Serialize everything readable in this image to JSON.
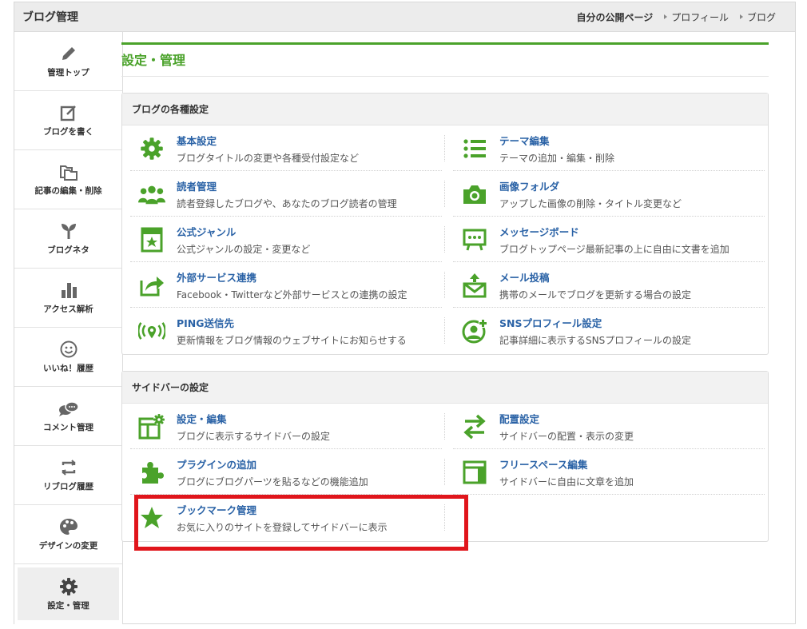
{
  "app": {
    "title": "ブログ管理"
  },
  "topnav": [
    {
      "label": "自分の公開ページ",
      "bold": true
    },
    {
      "label": "プロフィール"
    },
    {
      "label": "ブログ"
    }
  ],
  "sidebar": {
    "items": [
      {
        "label": "管理トップ",
        "icon": "pencil-icon"
      },
      {
        "label": "ブログを書く",
        "icon": "edit-icon"
      },
      {
        "label": "記事の編集・削除",
        "icon": "folders-icon"
      },
      {
        "label": "ブログネタ",
        "icon": "sprout-icon"
      },
      {
        "label": "アクセス解析",
        "icon": "bar-chart-icon"
      },
      {
        "label": "いいね！履歴",
        "icon": "smile-icon"
      },
      {
        "label": "コメント管理",
        "icon": "comment-icon"
      },
      {
        "label": "リブログ履歴",
        "icon": "reblog-icon"
      },
      {
        "label": "デザインの変更",
        "icon": "palette-icon"
      },
      {
        "label": "設定・管理",
        "icon": "gear-icon",
        "active": true
      }
    ]
  },
  "main": {
    "title": "設定・管理",
    "sections": [
      {
        "title": "ブログの各種設定",
        "items": [
          {
            "title": "基本設定",
            "desc": "ブログタイトルの変更や各種受付設定など",
            "icon": "gear-icon"
          },
          {
            "title": "テーマ編集",
            "desc": "テーマの追加・編集・削除",
            "icon": "list-icon"
          },
          {
            "title": "読者管理",
            "desc": "読者登録したブログや、あなたのブログ読者の管理",
            "icon": "users-icon"
          },
          {
            "title": "画像フォルダ",
            "desc": "アップした画像の削除・タイトル変更など",
            "icon": "camera-icon"
          },
          {
            "title": "公式ジャンル",
            "desc": "公式ジャンルの設定・変更など",
            "icon": "genre-icon"
          },
          {
            "title": "メッセージボード",
            "desc": "ブログトップページ最新記事の上に自由に文書を追加",
            "icon": "board-icon"
          },
          {
            "title": "外部サービス連携",
            "desc": "Facebook・Twitterなど外部サービスとの連携の設定",
            "icon": "share-icon"
          },
          {
            "title": "メール投稿",
            "desc": "携帯のメールでブログを更新する場合の設定",
            "icon": "mail-upload-icon"
          },
          {
            "title": "PING送信先",
            "desc": "更新情報をブログ情報のウェブサイトにお知らせする",
            "icon": "ping-icon"
          },
          {
            "title": "SNSプロフィール設定",
            "desc": "記事詳細に表示するSNSプロフィールの設定",
            "icon": "profile-add-icon"
          }
        ]
      },
      {
        "title": "サイドバーの設定",
        "items": [
          {
            "title": "設定・編集",
            "desc": "ブログに表示するサイドバーの設定",
            "icon": "sidebar-settings-icon"
          },
          {
            "title": "配置設定",
            "desc": "サイドバーの配置・表示の変更",
            "icon": "swap-icon"
          },
          {
            "title": "プラグインの追加",
            "desc": "ブログにブログパーツを貼るなどの機能追加",
            "icon": "puzzle-icon"
          },
          {
            "title": "フリースペース編集",
            "desc": "サイドバーに自由に文章を追加",
            "icon": "free-space-icon"
          },
          {
            "title": "ブックマーク管理",
            "desc": "お気に入りのサイトを登録してサイドバーに表示",
            "icon": "star-icon"
          }
        ]
      }
    ]
  },
  "colors": {
    "accent": "#4aa22a",
    "link": "#2a62a6",
    "highlight": "#e0151b"
  }
}
